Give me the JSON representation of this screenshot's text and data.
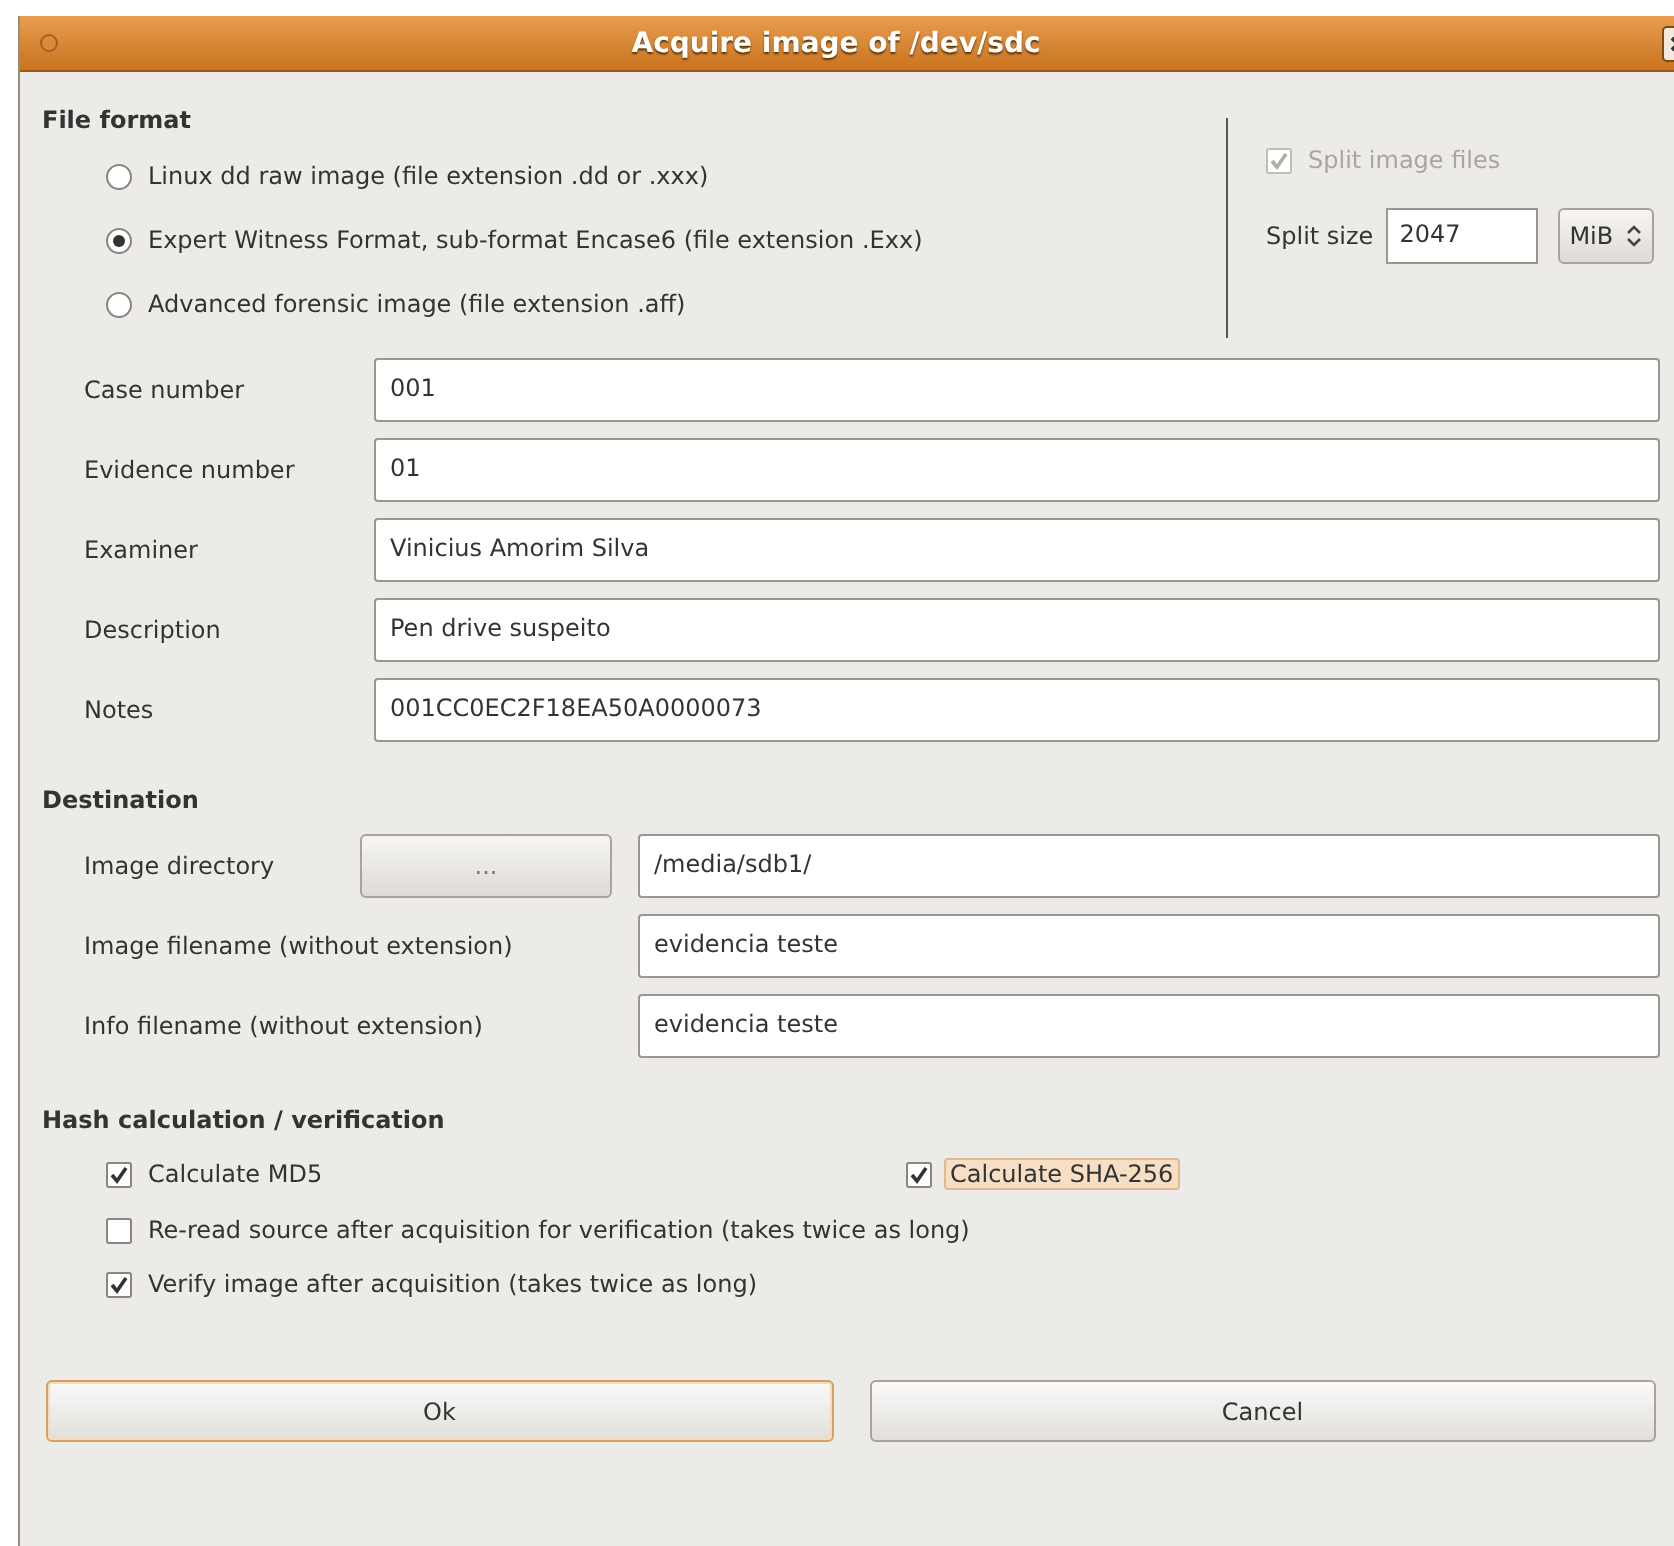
{
  "window": {
    "title": "Acquire image of /dev/sdc"
  },
  "file_format": {
    "heading": "File format",
    "options": [
      {
        "label": "Linux dd raw image (file extension .dd or .xxx)",
        "selected": false
      },
      {
        "label": "Expert Witness Format, sub-format Encase6 (file extension .Exx)",
        "selected": true
      },
      {
        "label": "Advanced forensic image (file extension .aff)",
        "selected": false
      }
    ]
  },
  "split": {
    "checkbox": {
      "label": "Split image files",
      "checked": true,
      "disabled": true
    },
    "size_label": "Split size",
    "size_value": "2047",
    "unit": "MiB"
  },
  "case_fields": [
    {
      "label": "Case number",
      "value": "001"
    },
    {
      "label": "Evidence number",
      "value": "01"
    },
    {
      "label": "Examiner",
      "value": "Vinicius Amorim Silva"
    },
    {
      "label": "Description",
      "value": "Pen drive suspeito"
    },
    {
      "label": "Notes",
      "value": "001CC0EC2F18EA50A0000073"
    }
  ],
  "destination": {
    "heading": "Destination",
    "directory": {
      "label": "Image directory",
      "button": "...",
      "value": "/media/sdb1/"
    },
    "fields": [
      {
        "label": "Image filename (without extension)",
        "value": "evidencia teste"
      },
      {
        "label": "Info filename (without extension)",
        "value": "evidencia teste"
      }
    ]
  },
  "hash": {
    "heading": "Hash calculation / verification",
    "rows": [
      [
        {
          "label": "Calculate MD5",
          "checked": true,
          "focused": false
        },
        {
          "label": "Calculate SHA-256",
          "checked": true,
          "focused": true
        }
      ],
      [
        {
          "label": "Re-read source after acquisition for verification (takes twice as long)",
          "checked": false,
          "focused": false
        }
      ],
      [
        {
          "label": "Verify image after acquisition (takes twice as long)",
          "checked": true,
          "focused": false
        }
      ]
    ]
  },
  "buttons": [
    {
      "label": "Ok",
      "default": true
    },
    {
      "label": "Cancel",
      "default": false
    }
  ]
}
